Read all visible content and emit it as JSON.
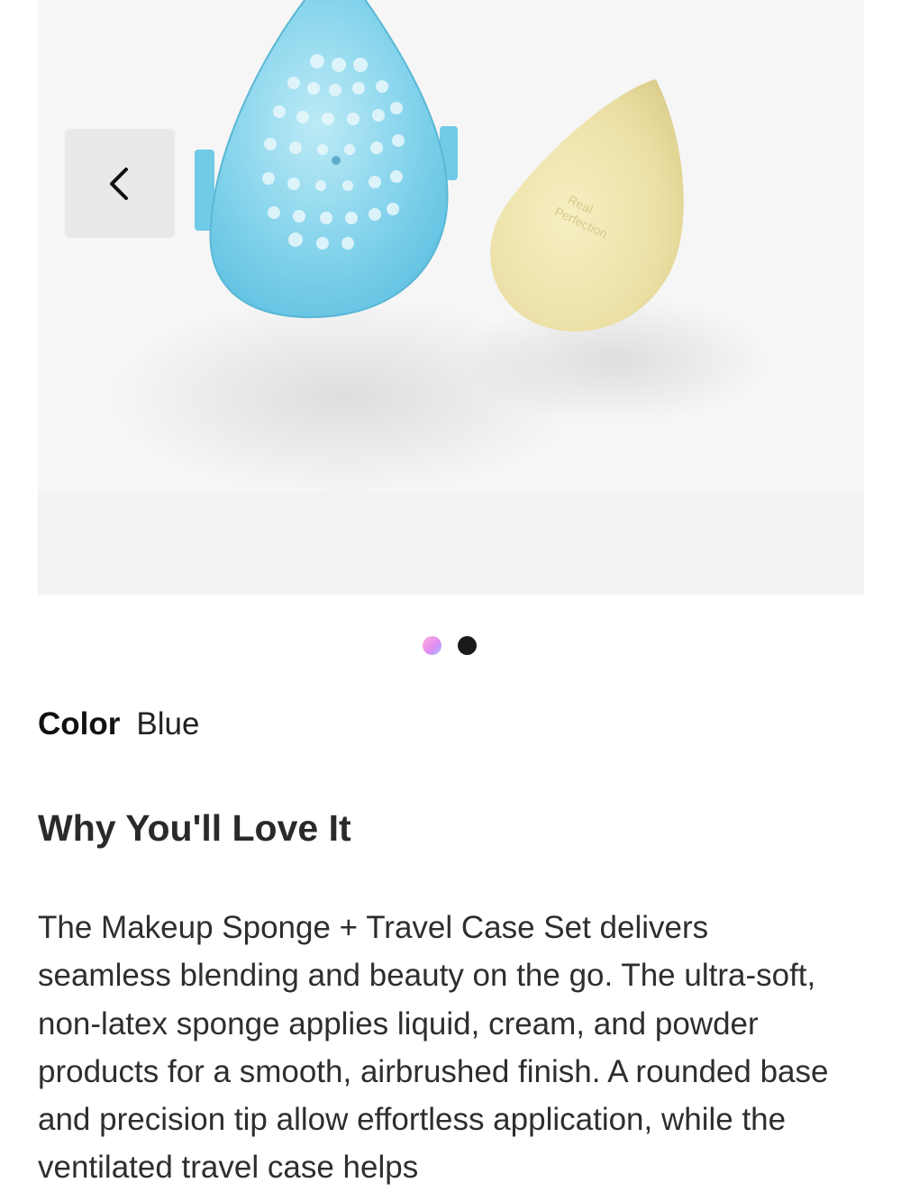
{
  "gallery": {
    "prev_icon": "chevron-left-icon",
    "sponge_print": [
      "Real",
      "Perfection"
    ],
    "dots": [
      {
        "name": "color-swatch-dot",
        "color": "#e38cf2",
        "active": false
      },
      {
        "name": "image-dot",
        "color": "#1a1a1a",
        "active": true
      }
    ]
  },
  "color": {
    "label": "Color",
    "value": "Blue"
  },
  "section": {
    "heading": "Why You'll Love It",
    "body": "The Makeup Sponge + Travel Case Set delivers seamless blending and beauty on the go. The ultra-soft, non-latex sponge applies liquid, cream, and powder products for a smooth, airbrushed finish. A rounded base and precision tip allow effortless application, while the ventilated travel case helps"
  },
  "colors": {
    "case_blue": "#7fd3ea",
    "sponge_yellow": "#efe6b0",
    "gallery_bg": "#f6f6f6"
  }
}
